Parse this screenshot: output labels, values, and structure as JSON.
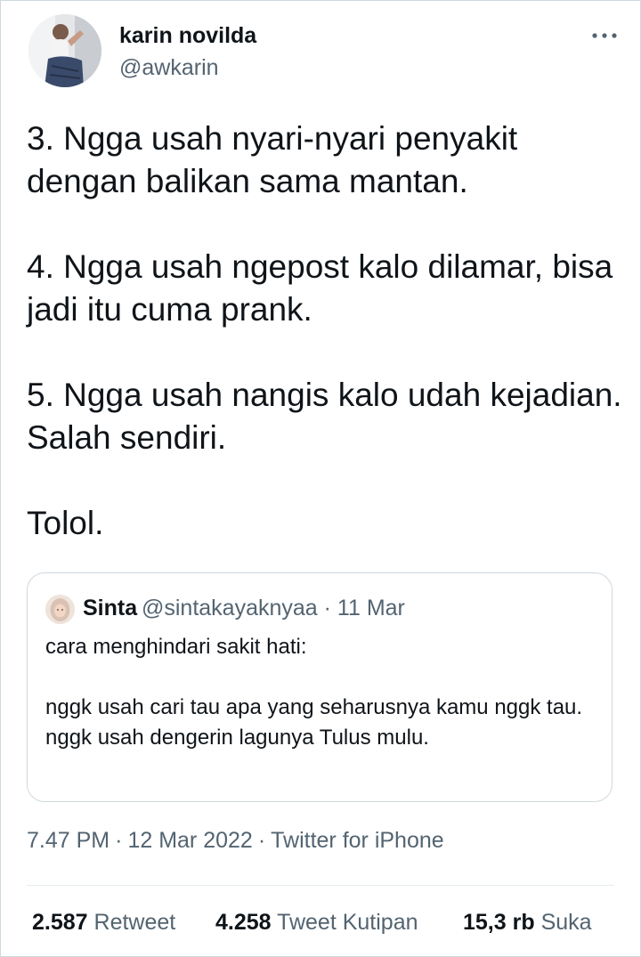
{
  "tweet": {
    "author": {
      "name": "karin novilda",
      "handle": "@awkarin"
    },
    "text_paragraphs": [
      "3. Ngga usah nyari-nyari penyakit dengan balikan sama mantan.",
      "4. Ngga usah ngepost kalo dilamar, bisa jadi itu cuma prank.",
      "5. Ngga usah nangis kalo udah kejadian. Salah sendiri.",
      "Tolol."
    ],
    "quote": {
      "name": "Sinta",
      "handle_date": "@sintakayaknyaa · 11 Mar",
      "line1": "cara menghindari sakit hati:",
      "line2": "nggk usah cari tau apa yang seharusnya kamu nggk tau.",
      "line3": "nggk usah dengerin lagunya Tulus mulu."
    },
    "meta": {
      "time": "7.47 PM",
      "date": "12 Mar 2022",
      "separator": "·",
      "source": "Twitter for iPhone"
    },
    "stats": {
      "retweets_count": "2.587",
      "retweets_label": "Retweet",
      "quotes_count": "4.258",
      "quotes_label": "Tweet Kutipan",
      "likes_count": "15,3 rb",
      "likes_label": "Suka"
    }
  },
  "icons": {
    "more": "more-horizontal-icon"
  },
  "colors": {
    "text_primary": "#0f1419",
    "text_secondary": "#536471",
    "border": "#cfd9de"
  }
}
